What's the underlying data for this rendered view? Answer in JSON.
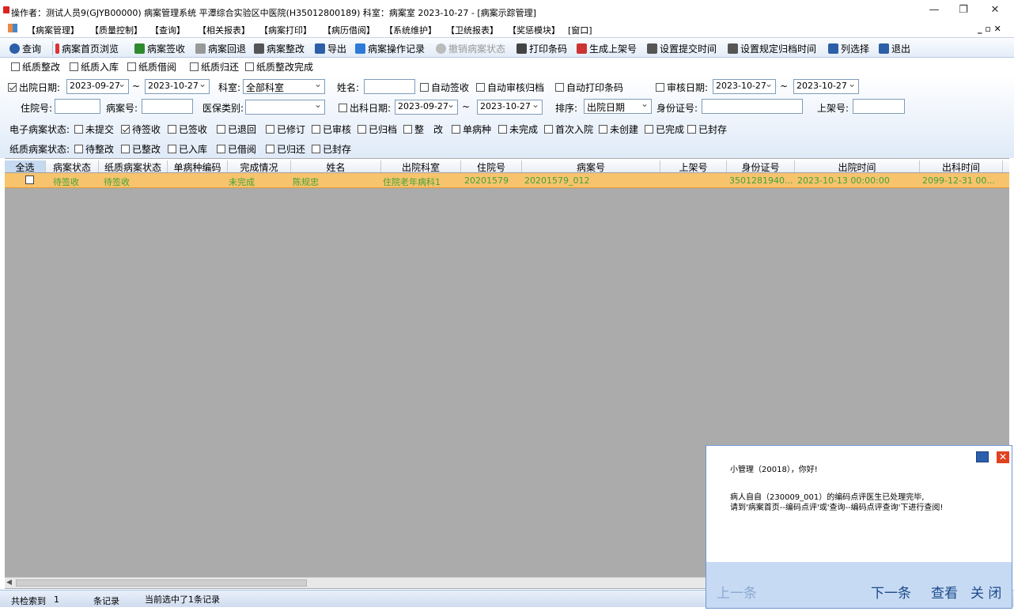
{
  "window": {
    "title": "操作者：测试人员9(GJYB00000) 病案管理系统  平潭综合实验区中医院(H35012800189)  科室：病案室 2023-10-27  - [病案示踪管理]",
    "min": "—",
    "restore": "❐",
    "close": "✕",
    "mdi_controls": "_ ▫ ✕"
  },
  "menu": [
    "【病案管理】",
    "【质量控制】",
    "【查询】",
    "【相关报表】",
    "【病案打印】",
    "【病历借阅】",
    "【系统维护】",
    "【卫统报表】",
    "【奖惩模块】",
    "[窗口]"
  ],
  "toolbar": [
    {
      "label": "查询",
      "icon": "search-icon",
      "color": "#2d5fa8"
    },
    {
      "label": "病案首页浏览",
      "icon": "cursor-icon",
      "color": "#d33"
    },
    {
      "label": "病案签收",
      "icon": "check-icon",
      "color": "#2f8a2f"
    },
    {
      "label": "病案回退",
      "icon": "undo-icon",
      "color": "#888"
    },
    {
      "label": "病案整改",
      "icon": "edit-icon",
      "color": "#333"
    },
    {
      "label": "导出",
      "icon": "export-icon",
      "color": "#2d5fa8"
    },
    {
      "label": "病案操作记录",
      "icon": "sigma-icon",
      "color": "#2d7ad8"
    },
    {
      "label": "撤销病案状态",
      "icon": "info-icon",
      "color": "#aaa"
    },
    {
      "label": "打印条码",
      "icon": "printer-icon",
      "color": "#333"
    },
    {
      "label": "生成上架号",
      "icon": "shelf-icon",
      "color": "#c33"
    },
    {
      "label": "设置提交时间",
      "icon": "calendar-icon",
      "color": "#333"
    },
    {
      "label": "设置规定归档时间",
      "icon": "calendar-icon",
      "color": "#333"
    },
    {
      "label": "列选择",
      "icon": "columns-icon",
      "color": "#2d5fa8"
    },
    {
      "label": "退出",
      "icon": "exit-icon",
      "color": "#2d5fa8"
    }
  ],
  "paper_tabs": [
    {
      "label": "纸质整改",
      "checked": false
    },
    {
      "label": "纸质入库",
      "checked": false
    },
    {
      "label": "纸质借阅",
      "checked": false
    },
    {
      "label": "纸质归还",
      "checked": false
    },
    {
      "label": "纸质整改完成",
      "checked": false
    }
  ],
  "filters": {
    "discharge_date_label": "出院日期:",
    "discharge_from": "2023-09-27",
    "tilde": "~",
    "discharge_to": "2023-10-27",
    "dept_label": "科室:",
    "dept_value": "全部科室",
    "name_label": "姓名:",
    "auto_sign": "自动签收",
    "auto_audit": "自动审核归档",
    "auto_print": "自动打印条码",
    "audit_date_label": "审核日期:",
    "audit_from": "2023-10-27",
    "audit_to": "2023-10-27",
    "inpatient_label": "住院号:",
    "record_label": "病案号:",
    "insurance_label": "医保类别:",
    "out_dept_date_label": "出科日期:",
    "out_from": "2023-09-27",
    "out_to": "2023-10-27",
    "sort_label": "排序:",
    "sort_value": "出院日期",
    "id_label": "身份证号:",
    "shelf_label": "上架号:"
  },
  "e_status": {
    "label": "电子病案状态:",
    "items": [
      {
        "l": "未提交",
        "c": false
      },
      {
        "l": "待签收",
        "c": true
      },
      {
        "l": "已签收",
        "c": false
      },
      {
        "l": "已退回",
        "c": false
      },
      {
        "l": "已修订",
        "c": false
      },
      {
        "l": "已审核",
        "c": false
      },
      {
        "l": "已归档",
        "c": false
      },
      {
        "l": "整　改",
        "c": false
      },
      {
        "l": "单病种",
        "c": false
      },
      {
        "l": "未完成",
        "c": false
      },
      {
        "l": "首次入院",
        "c": false
      },
      {
        "l": "未创建",
        "c": false
      },
      {
        "l": "已完成",
        "c": false
      },
      {
        "l": "已封存",
        "c": false
      }
    ]
  },
  "p_status": {
    "label": "纸质病案状态:",
    "items": [
      {
        "l": "待整改",
        "c": false
      },
      {
        "l": "已整改",
        "c": false
      },
      {
        "l": "已入库",
        "c": false
      },
      {
        "l": "已借阅",
        "c": false
      },
      {
        "l": "已归还",
        "c": false
      },
      {
        "l": "已封存",
        "c": false
      }
    ]
  },
  "columns": [
    "全选",
    "病案状态",
    "纸质病案状态",
    "单病种编码",
    "完成情况",
    "姓名",
    "出院科室",
    "住院号",
    "病案号",
    "上架号",
    "身份证号",
    "出院时间",
    "出科时间"
  ],
  "rows": [
    [
      "",
      "待签收",
      "待签收",
      "",
      "未完成",
      "陈规忠",
      "住院老年病科1",
      "20201579",
      "20201579_012",
      "",
      "3501281940...",
      "2023-10-13 00:00:00",
      "2099-12-31 00..."
    ]
  ],
  "status": {
    "found_label": "共检索到",
    "count": "1",
    "records": "条记录",
    "selected": "当前选中了1条记录"
  },
  "popup": {
    "greeting": "小管理（20018），你好!",
    "line1": "病人自自（230009_001）的编码点评医生已处理完毕,",
    "line2": "请到'病案首页--编码点评'或'查询--编码点评查询'下进行查阅!",
    "prev": "上一条",
    "next": "下一条",
    "view": "查看",
    "close": "关 闭"
  },
  "colors": {
    "row_highlight": "#f8c36d",
    "status_green": "#3fa338",
    "grid_bg": "#ababab"
  }
}
